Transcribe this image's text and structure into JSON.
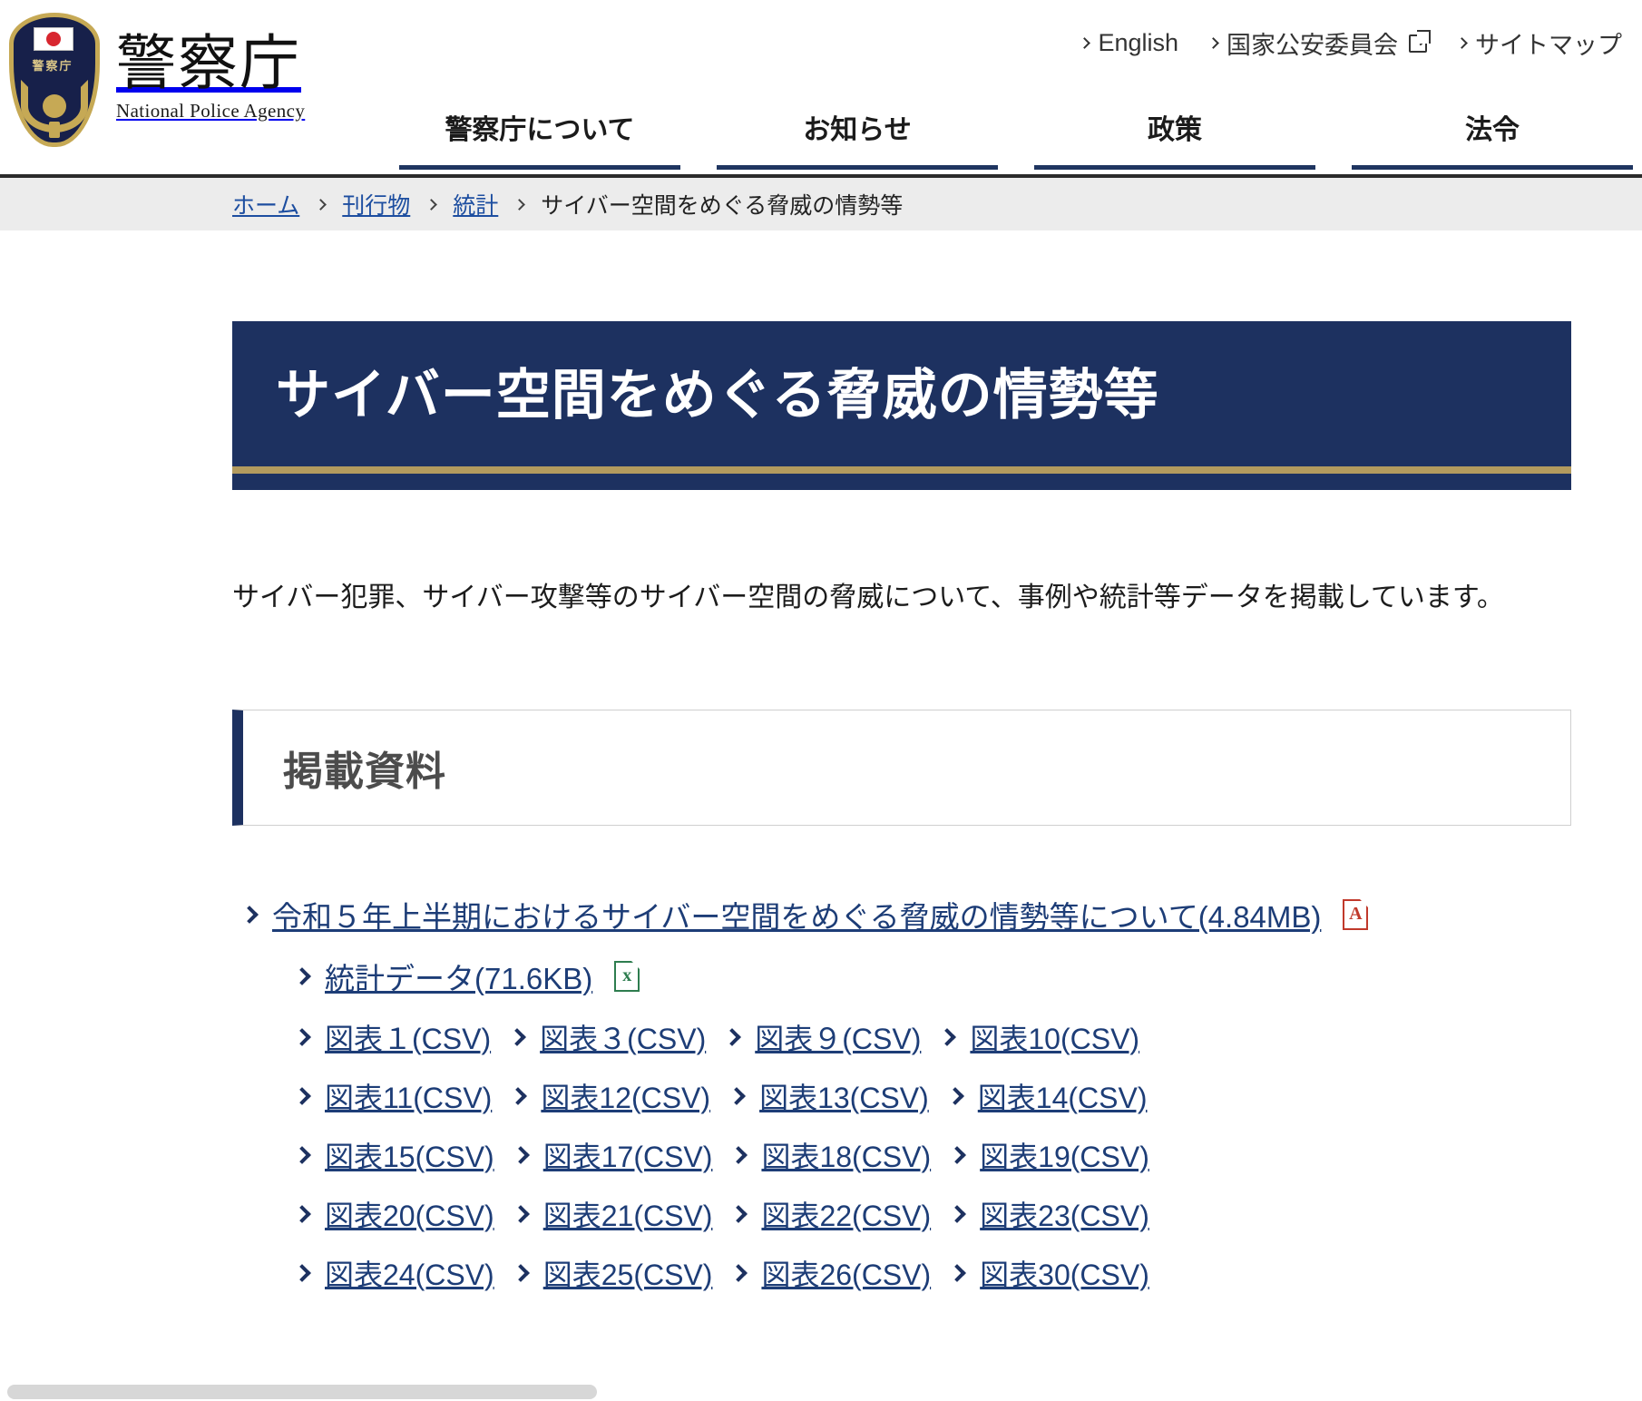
{
  "header": {
    "brand_jp": "警察庁",
    "brand_en": "National Police Agency",
    "crest_label": "警察庁",
    "utility_nav": [
      {
        "label": "English",
        "external": false
      },
      {
        "label": "国家公安委員会",
        "external": true
      },
      {
        "label": "サイトマップ",
        "external": false
      }
    ],
    "main_nav": [
      {
        "label": "警察庁について"
      },
      {
        "label": "お知らせ"
      },
      {
        "label": "政策"
      },
      {
        "label": "法令"
      }
    ]
  },
  "breadcrumb": {
    "items": [
      {
        "label": "ホーム",
        "link": true
      },
      {
        "label": "刊行物",
        "link": true
      },
      {
        "label": "統計",
        "link": true
      },
      {
        "label": "サイバー空間をめぐる脅威の情勢等",
        "link": false
      }
    ]
  },
  "page": {
    "title": "サイバー空間をめぐる脅威の情勢等",
    "lead": "サイバー犯罪、サイバー攻撃等のサイバー空間の脅威について、事例や統計等データを掲載しています。",
    "section_title": "掲載資料"
  },
  "resources": {
    "pdf": {
      "label": "令和５年上半期におけるサイバー空間をめぐる脅威の情勢等について(4.84MB)",
      "icon": "pdf-file-icon",
      "icon_glyph": "A",
      "icon_color": "#c0392b"
    },
    "excel": {
      "label": "統計データ(71.6KB)",
      "icon": "excel-file-icon",
      "icon_glyph": "x",
      "icon_color": "#2e7d4f"
    },
    "csv_rows": [
      [
        "図表１(CSV)",
        "図表３(CSV)",
        "図表９(CSV)",
        "図表10(CSV)"
      ],
      [
        "図表11(CSV)",
        "図表12(CSV)",
        "図表13(CSV)",
        "図表14(CSV)"
      ],
      [
        "図表15(CSV)",
        "図表17(CSV)",
        "図表18(CSV)",
        "図表19(CSV)"
      ],
      [
        "図表20(CSV)",
        "図表21(CSV)",
        "図表22(CSV)",
        "図表23(CSV)"
      ],
      [
        "図表24(CSV)",
        "図表25(CSV)",
        "図表26(CSV)",
        "図表30(CSV)"
      ]
    ]
  },
  "colors": {
    "navy": "#1d3160",
    "gold": "#b39b5e",
    "link": "#1d3d77",
    "breadcrumb_link": "#1d4ea0",
    "breadcrumb_bg": "#ececec"
  }
}
